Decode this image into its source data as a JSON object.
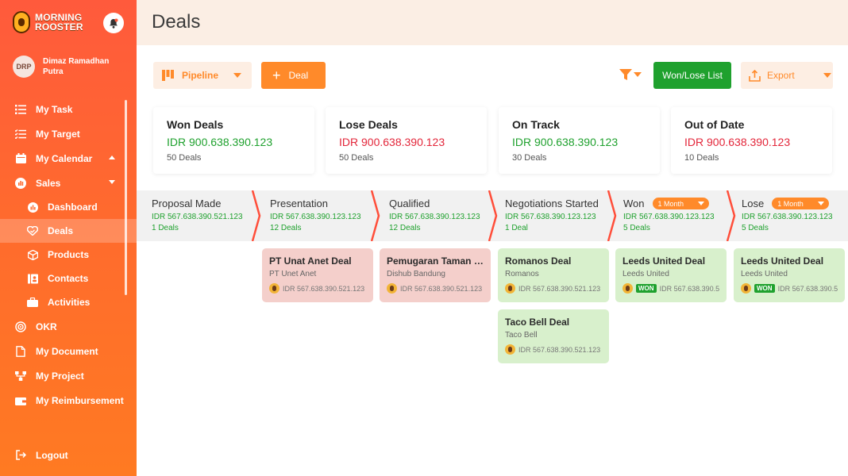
{
  "brand": {
    "line1": "MORNING",
    "line2": "ROOSTER"
  },
  "user": {
    "initials": "DRP",
    "name": "Dimaz Ramadhan Putra"
  },
  "nav": {
    "my_task": "My Task",
    "my_target": "My Target",
    "my_calendar": "My Calendar",
    "sales": "Sales",
    "dashboard": "Dashboard",
    "deals": "Deals",
    "products": "Products",
    "contacts": "Contacts",
    "activities": "Activities",
    "okr": "OKR",
    "my_document": "My Document",
    "my_project": "My Project",
    "my_reimbursement": "My Reimbursement",
    "logout": "Logout"
  },
  "header": {
    "title": "Deals"
  },
  "toolbar": {
    "pipeline": "Pipeline",
    "deal": "Deal",
    "won_lose_list": "Won/Lose List",
    "export": "Export"
  },
  "summary": [
    {
      "title": "Won Deals",
      "amount": "IDR 900.638.390.123",
      "count": "50 Deals"
    },
    {
      "title": "Lose Deals",
      "amount": "IDR 900.638.390.123",
      "count": "50 Deals"
    },
    {
      "title": "On Track",
      "amount": "IDR 900.638.390.123",
      "count": "30 Deals"
    },
    {
      "title": "Out of Date",
      "amount": "IDR 900.638.390.123",
      "count": "10 Deals"
    }
  ],
  "stages": [
    {
      "name": "Proposal Made",
      "amount": "IDR 567.638.390.521.123",
      "count": "1 Deals"
    },
    {
      "name": "Presentation",
      "amount": "IDR 567.638.390.123.123",
      "count": "12 Deals"
    },
    {
      "name": "Qualified",
      "amount": "IDR 567.638.390.123.123",
      "count": "12 Deals"
    },
    {
      "name": "Negotiations Started",
      "amount": "IDR 567.638.390.123.123",
      "count": "1 Deal"
    },
    {
      "name": "Won",
      "filter": "1 Month",
      "amount": "IDR 567.638.390.123.123",
      "count": "5 Deals"
    },
    {
      "name": "Lose",
      "filter": "1 Month",
      "amount": "IDR 567.638.390.123.123",
      "count": "5 Deals"
    }
  ],
  "deals": [
    {
      "title": "PT Unat Anet Deal",
      "company": "PT Unet Anet",
      "amount": "IDR 567.638.390.521.123"
    },
    {
      "title": "Pemugaran Taman La...",
      "company": "Dishub Bandung",
      "amount": "IDR 567.638.390.521.123"
    },
    {
      "title": "Romanos Deal",
      "company": "Romanos",
      "amount": "IDR 567.638.390.521.123"
    },
    {
      "title": "Taco Bell Deal",
      "company": "Taco Bell",
      "amount": "IDR 567.638.390.521.123"
    },
    {
      "title": "Leeds United Deal",
      "company": "Leeds United",
      "badge": "WON",
      "amount": "IDR 567.638.390.5..."
    },
    {
      "title": "Leeds United Deal",
      "company": "Leeds United",
      "badge": "WON",
      "amount": "IDR 567.638.390.5..."
    }
  ],
  "colors": {
    "accent": "#ff8a2a",
    "won": "#1fa12e",
    "lose": "#e3263a",
    "sidebar_top": "#ff5a3c",
    "sidebar_bottom": "#ff7a22"
  }
}
